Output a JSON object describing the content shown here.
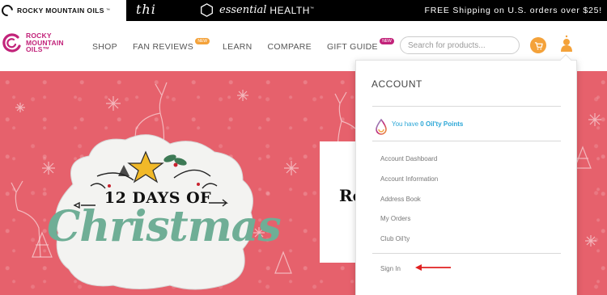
{
  "topbar": {
    "rmo_brand": "ROCKY MOUNTAIN OILS",
    "rmo_tm": "™",
    "thi_brand": "thi",
    "eh_brand_italic": "essential",
    "eh_brand_caps": "HEALTH",
    "eh_tm": "™",
    "shipping_message": "FREE Shipping on U.S. orders over $25!"
  },
  "logo": {
    "line1": "ROCKY",
    "line2": "MOUNTAIN",
    "line3": "OILS™"
  },
  "nav": {
    "items": [
      {
        "label": "SHOP"
      },
      {
        "label": "FAN REVIEWS",
        "badge": "NEW",
        "badge_color": "#f4a23a"
      },
      {
        "label": "LEARN"
      },
      {
        "label": "COMPARE"
      },
      {
        "label": "GIFT GUIDE",
        "badge": "NEW",
        "badge_color": "#c2237a"
      }
    ]
  },
  "search": {
    "placeholder": "Search for products..."
  },
  "icons": {
    "cart": "cart-icon",
    "user": "user-icon"
  },
  "hero": {
    "days_text": "12 DAYS OF",
    "christmas_text": "Christmas",
    "promo_partial": "Ro"
  },
  "account_menu": {
    "title": "ACCOUNT",
    "points_prefix": "You have ",
    "points_value": "0 Oil'ty Points",
    "links": [
      "Account Dashboard",
      "Account Information",
      "Address Book",
      "My Orders",
      "Club Oil'ty"
    ],
    "sign_in": "Sign In"
  },
  "colors": {
    "brand_magenta": "#c2237a",
    "accent_orange": "#f4a23a",
    "hero_pink": "#e6616c",
    "points_blue": "#2aa6d6",
    "annotation_red": "#e02020"
  }
}
